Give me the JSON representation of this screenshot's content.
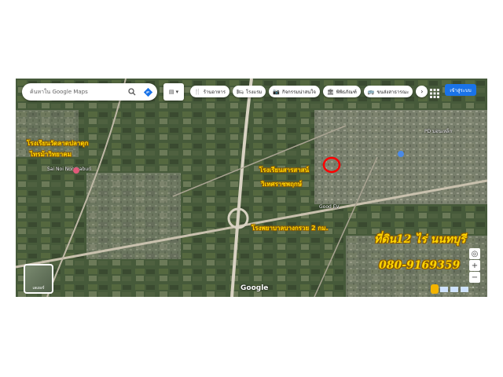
{
  "search": {
    "placeholder": "ค้นหาใน Google Maps",
    "search_icon": "search-icon",
    "directions_icon": "directions-icon"
  },
  "chips": [
    {
      "icon": "🍴",
      "label": "ร้านอาหาร"
    },
    {
      "icon": "🛏",
      "label": "โรงแรม"
    },
    {
      "icon": "📷",
      "label": "กิจกรรมน่าสนใจ"
    },
    {
      "icon": "🏛",
      "label": "พิพิธภัณฑ์"
    },
    {
      "icon": "🚌",
      "label": "ขนส่งสาธารณะ"
    }
  ],
  "chip_next": "›",
  "signin_label": "เข้าสู่ระบบ",
  "map_labels": {
    "sai_noi": "Sai Noi Nonthaburi",
    "pd": "PD มอนเหล็ก",
    "good_ev": "Good EV"
  },
  "annotations": {
    "school_1": "โรงเรียนวัดลาดปลาดุก",
    "school_1b": "ไทรม้าวิทยาคม",
    "school_2": "โรงเรียนสารสาสน์",
    "school_2b": "วิเทศราชพฤกษ์",
    "hospital": "โรงพยาบาลบางกรวย 2 กม.",
    "land_title": "ที่ดิน12 ไร่ นนทบุรี",
    "phone": "080-9169359"
  },
  "thumb_label": "เลเยอร์",
  "google_logo": "Google",
  "zoom": {
    "plus": "+",
    "minus": "−"
  },
  "colors": {
    "accent": "#1a73e8",
    "annotation": "#ffd400",
    "marker": "#ff0000"
  }
}
